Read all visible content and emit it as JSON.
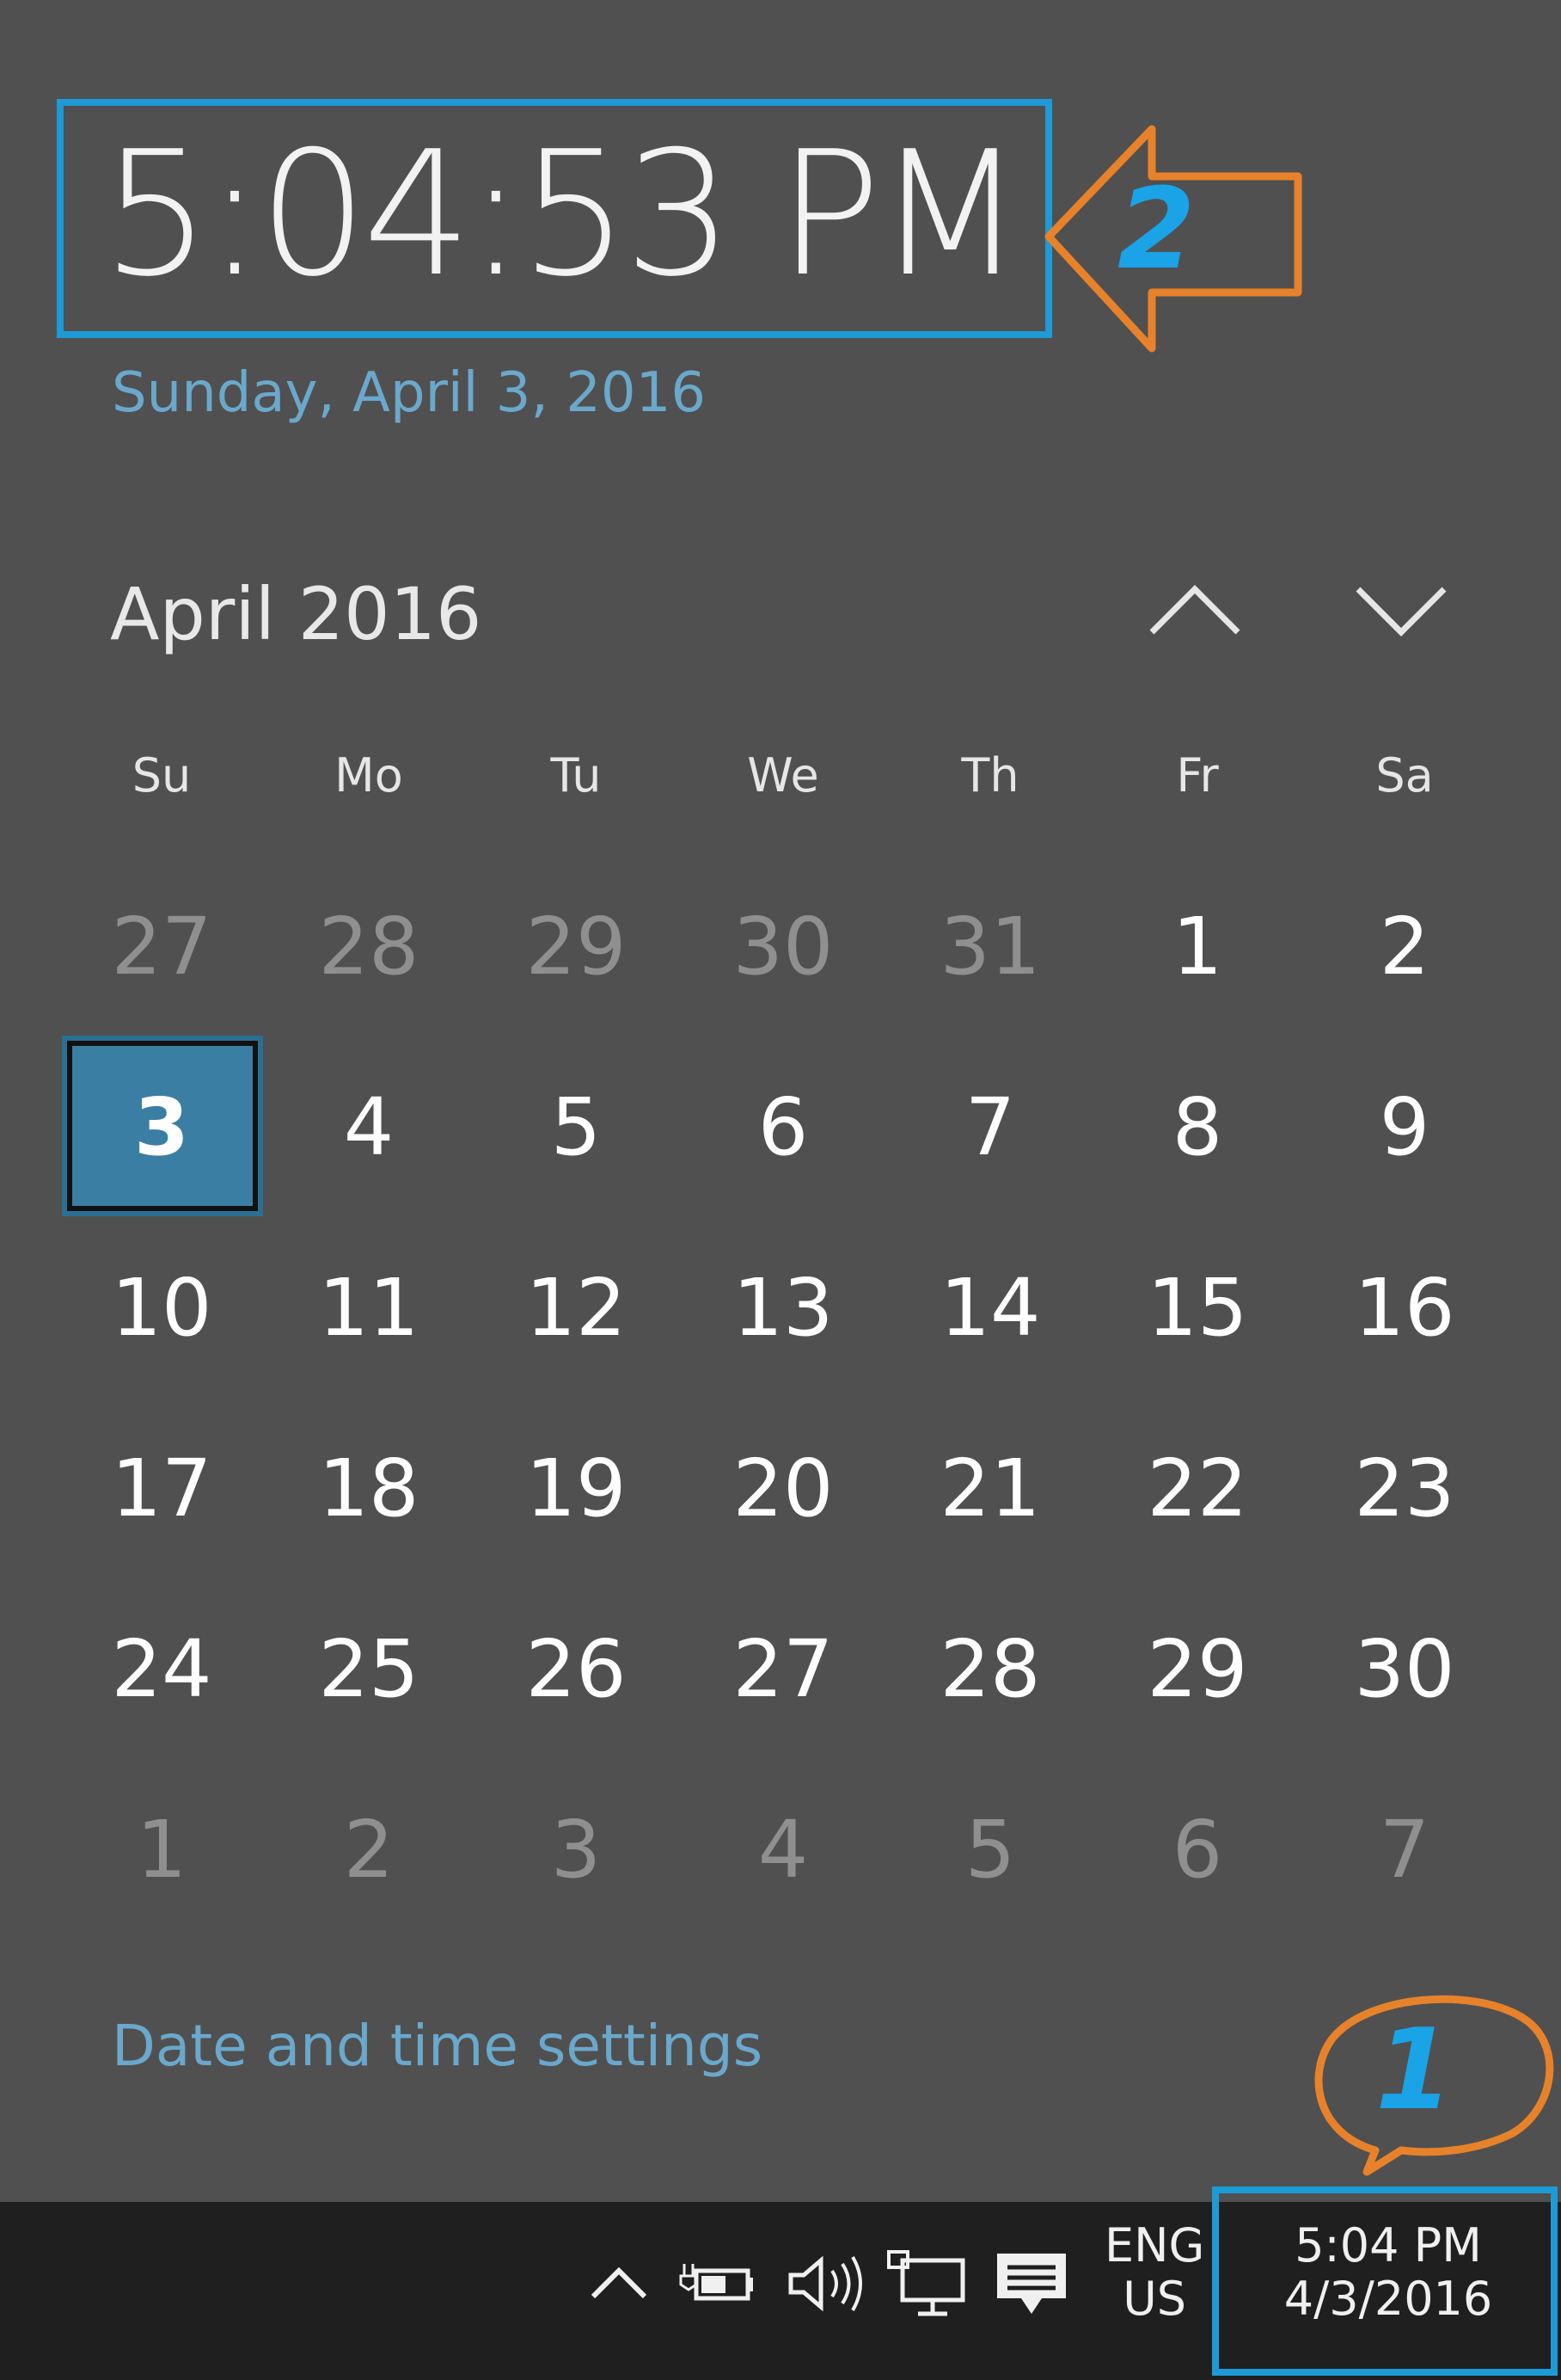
{
  "flyout": {
    "time": "5:04:53 PM",
    "date_long": "Sunday, April 3, 2016",
    "month_title": "April 2016",
    "weekdays": [
      "Su",
      "Mo",
      "Tu",
      "We",
      "Th",
      "Fr",
      "Sa"
    ],
    "weeks": [
      [
        "27",
        "28",
        "29",
        "30",
        "31",
        "1",
        "2"
      ],
      [
        "3",
        "4",
        "5",
        "6",
        "7",
        "8",
        "9"
      ],
      [
        "10",
        "11",
        "12",
        "13",
        "14",
        "15",
        "16"
      ],
      [
        "17",
        "18",
        "19",
        "20",
        "21",
        "22",
        "23"
      ],
      [
        "24",
        "25",
        "26",
        "27",
        "28",
        "29",
        "30"
      ],
      [
        "1",
        "2",
        "3",
        "4",
        "5",
        "6",
        "7"
      ]
    ],
    "other_month_flags": [
      [
        true,
        true,
        true,
        true,
        true,
        false,
        false
      ],
      [
        false,
        false,
        false,
        false,
        false,
        false,
        false
      ],
      [
        false,
        false,
        false,
        false,
        false,
        false,
        false
      ],
      [
        false,
        false,
        false,
        false,
        false,
        false,
        false
      ],
      [
        false,
        false,
        false,
        false,
        false,
        false,
        false
      ],
      [
        true,
        true,
        true,
        true,
        true,
        true,
        true
      ]
    ],
    "selected_day": "3",
    "settings_link": "Date and time settings"
  },
  "taskbar": {
    "lang_line1": "ENG",
    "lang_line2": "US",
    "clock_time": "5:04 PM",
    "clock_date": "4/3/2016",
    "icons": [
      "chevron-up-icon",
      "battery-power-icon",
      "volume-icon",
      "network-icon",
      "action-center-icon"
    ]
  },
  "annotations": {
    "label_1": "1",
    "label_2": "2",
    "box_color": "#1e9ad6",
    "arrow_color": "#e8822a"
  }
}
